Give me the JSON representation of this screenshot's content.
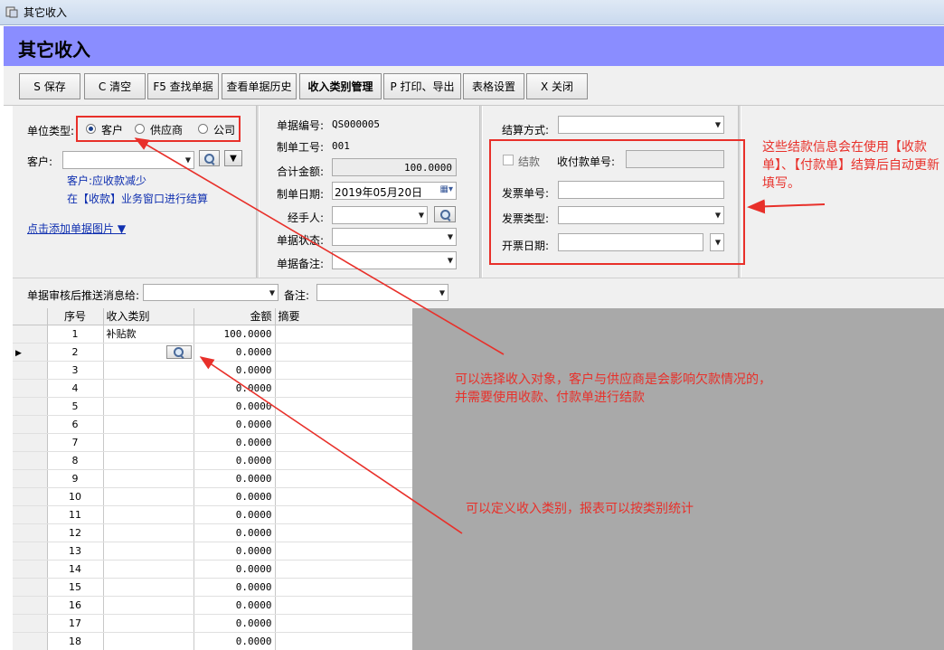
{
  "window": {
    "title": "其它收入"
  },
  "header": {
    "title": "其它收入"
  },
  "toolbar": {
    "buttons": [
      {
        "label": "S 保存"
      },
      {
        "label": "C 清空"
      },
      {
        "label": "F5 查找单据"
      },
      {
        "label": "查看单据历史"
      },
      {
        "label": "收入类别管理"
      },
      {
        "label": "P 打印、导出"
      },
      {
        "label": "表格设置"
      },
      {
        "label": "X 关闭"
      }
    ]
  },
  "form": {
    "unit_type_label": "单位类型:",
    "unit_types": [
      "客户",
      "供应商",
      "公司"
    ],
    "customer_label": "客户:",
    "customer_hint1": "客户:应收款减少",
    "customer_hint2": "在【收款】业务窗口进行结算",
    "add_image_link": "点击添加单据图片 ▼",
    "doc_no_label": "单据编号:",
    "doc_no": "QS000005",
    "staff_no_label": "制单工号:",
    "staff_no": "001",
    "total_label": "合计金额:",
    "total": "100.0000",
    "date_label": "制单日期:",
    "date": "2019年05月20日",
    "handler_label": "经手人:",
    "status_label": "单据状态:",
    "remark_label": "单据备注:",
    "settle_method_label": "结算方式:",
    "settle_label": "结款",
    "receipt_no_label": "收付款单号:",
    "invoice_no_label": "发票单号:",
    "invoice_type_label": "发票类型:",
    "invoice_date_label": "开票日期:",
    "notify_label": "单据审核后推送消息给:",
    "notify_remark_label": "备注:"
  },
  "grid": {
    "columns": [
      "序号",
      "收入类别",
      "金额",
      "摘要"
    ],
    "rows": [
      {
        "no": "1",
        "category": "补贴款",
        "amount": "100.0000"
      },
      {
        "no": "2",
        "category": "",
        "amount": "0.0000"
      },
      {
        "no": "3",
        "category": "",
        "amount": "0.0000"
      },
      {
        "no": "4",
        "category": "",
        "amount": "0.0000"
      },
      {
        "no": "5",
        "category": "",
        "amount": "0.0000"
      },
      {
        "no": "6",
        "category": "",
        "amount": "0.0000"
      },
      {
        "no": "7",
        "category": "",
        "amount": "0.0000"
      },
      {
        "no": "8",
        "category": "",
        "amount": "0.0000"
      },
      {
        "no": "9",
        "category": "",
        "amount": "0.0000"
      },
      {
        "no": "10",
        "category": "",
        "amount": "0.0000"
      },
      {
        "no": "11",
        "category": "",
        "amount": "0.0000"
      },
      {
        "no": "12",
        "category": "",
        "amount": "0.0000"
      },
      {
        "no": "13",
        "category": "",
        "amount": "0.0000"
      },
      {
        "no": "14",
        "category": "",
        "amount": "0.0000"
      },
      {
        "no": "15",
        "category": "",
        "amount": "0.0000"
      },
      {
        "no": "16",
        "category": "",
        "amount": "0.0000"
      },
      {
        "no": "17",
        "category": "",
        "amount": "0.0000"
      },
      {
        "no": "18",
        "category": "",
        "amount": "0.0000"
      }
    ]
  },
  "annotations": {
    "settle_note": "这些结款信息会在使用【收款单】、【付款单】结算后自动更新填写。",
    "target_note_1": "可以选择收入对象，客户与供应商是会影响欠款情况的，",
    "target_note_2": "并需要使用收款、付款单进行结款",
    "category_note": "可以定义收入类别，报表可以按类别统计",
    "color": "#e8302a"
  },
  "colors": {
    "header_bg": "#8a8dff",
    "link": "#1030b0"
  }
}
